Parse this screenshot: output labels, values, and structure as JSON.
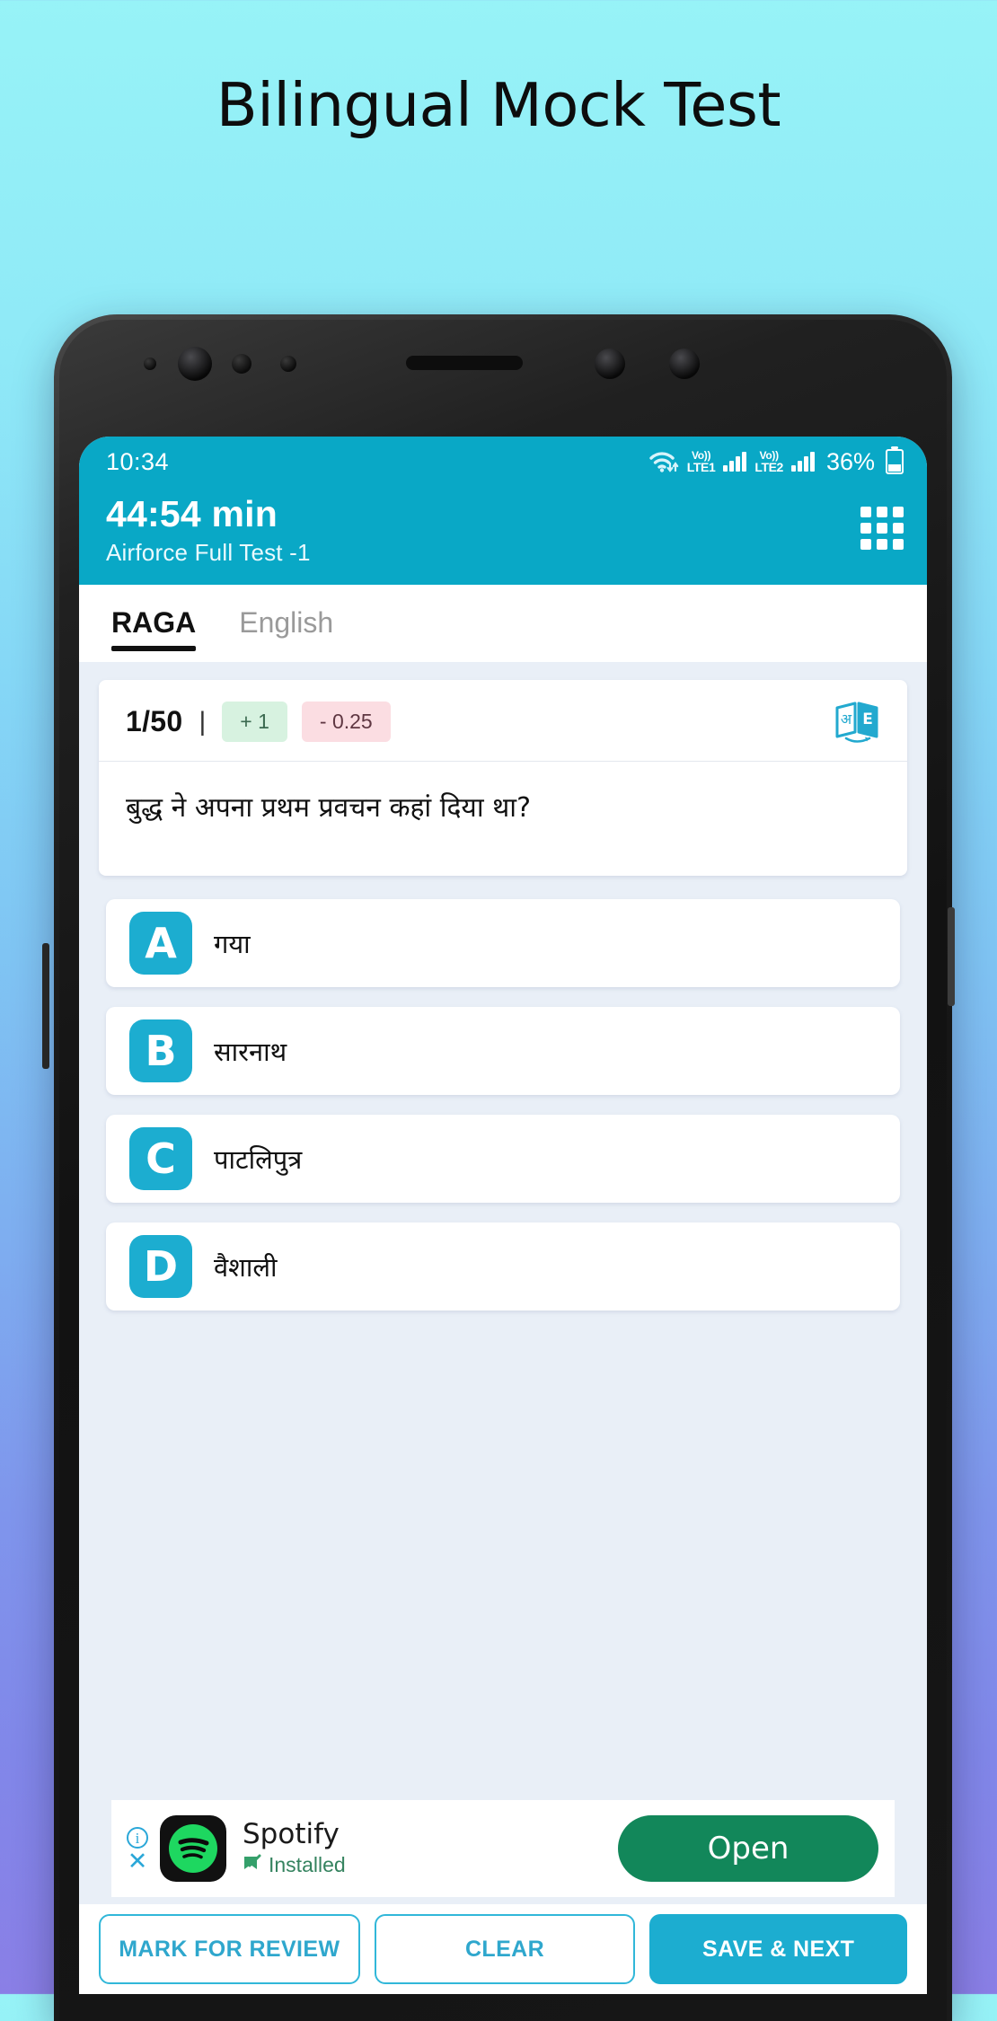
{
  "banner": {
    "title": "Bilingual Mock Test"
  },
  "status_bar": {
    "time": "10:34",
    "wifi": "wifi-icon",
    "sim1_label_top": "Vo))",
    "sim1_label_bottom": "LTE1",
    "sim2_label_top": "Vo))",
    "sim2_label_bottom": "LTE2",
    "battery": "36%"
  },
  "app_bar": {
    "timer": "44:54 min",
    "test_name": "Airforce Full Test -1",
    "grid_icon": "grid-menu-icon",
    "accent": "#09a8c6"
  },
  "tabs": [
    {
      "label": "RAGA",
      "active": true
    },
    {
      "label": "English",
      "active": false
    }
  ],
  "question": {
    "counter": "1/50",
    "separator": "|",
    "positive_marks": "+ 1",
    "negative_marks": "- 0.25",
    "translate_icon": "translate-icon",
    "translate_glyph_left": "अ",
    "translate_glyph_right": "E",
    "text": "बुद्ध ने अपना प्रथम प्रवचन कहां दिया था?"
  },
  "options": [
    {
      "letter": "A",
      "text": "गया"
    },
    {
      "letter": "B",
      "text": "सारनाथ"
    },
    {
      "letter": "C",
      "text": "पाटलिपुत्र"
    },
    {
      "letter": "D",
      "text": "वैशाली"
    }
  ],
  "ad": {
    "info_icon": "i",
    "close_icon": "✕",
    "app_name": "Spotify",
    "status": "Installed",
    "cta": "Open",
    "cta_color": "#12875a",
    "logo_color": "#1ed760"
  },
  "action_bar": {
    "mark_for_review": "MARK FOR REVIEW",
    "clear": "CLEAR",
    "save_next": "SAVE & NEXT",
    "accent": "#1cadd0"
  }
}
